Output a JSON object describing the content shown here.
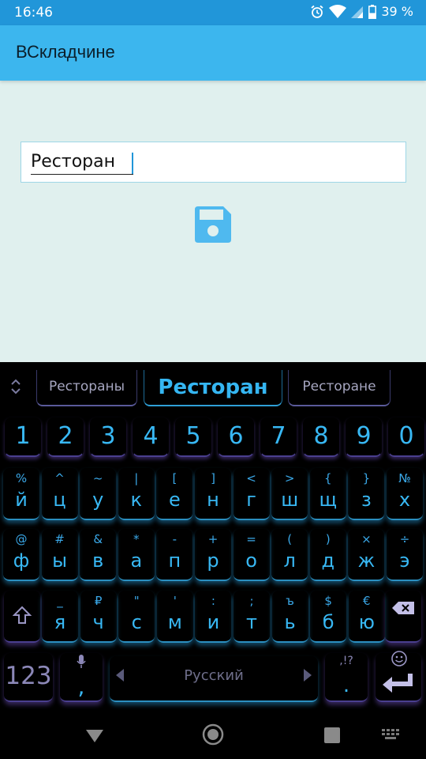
{
  "status": {
    "time": "16:46",
    "battery": "39 %"
  },
  "app": {
    "title": "ВСкладчине"
  },
  "form": {
    "name_value": "Ресторан"
  },
  "suggestions": [
    "Рестораны",
    "Ресторан",
    "Ресторане"
  ],
  "keyboard": {
    "numbers": [
      "1",
      "2",
      "3",
      "4",
      "5",
      "6",
      "7",
      "8",
      "9",
      "0"
    ],
    "row1": {
      "sub": [
        "%",
        "^",
        "~",
        "|",
        "[",
        "]",
        "<",
        ">",
        "{",
        "}",
        "№"
      ],
      "main": [
        "й",
        "ц",
        "у",
        "к",
        "е",
        "н",
        "г",
        "ш",
        "щ",
        "з",
        "х"
      ]
    },
    "row2": {
      "sub": [
        "@",
        "#",
        "&",
        "*",
        "-",
        "+",
        "=",
        "(",
        ")",
        "×",
        "÷"
      ],
      "main": [
        "ф",
        "ы",
        "в",
        "а",
        "п",
        "р",
        "о",
        "л",
        "д",
        "ж",
        "э"
      ]
    },
    "row3": {
      "sub": [
        "_",
        "₽",
        "\"",
        "'",
        ":",
        ";",
        "ъ",
        "$",
        "€"
      ],
      "main": [
        "я",
        "ч",
        "с",
        "м",
        "и",
        "т",
        "ь",
        "б",
        "ю"
      ]
    },
    "mode_label": "123",
    "comma_label": ",",
    "space_label": "Русский",
    "period_label": ".",
    "period_sub": ",!?"
  }
}
